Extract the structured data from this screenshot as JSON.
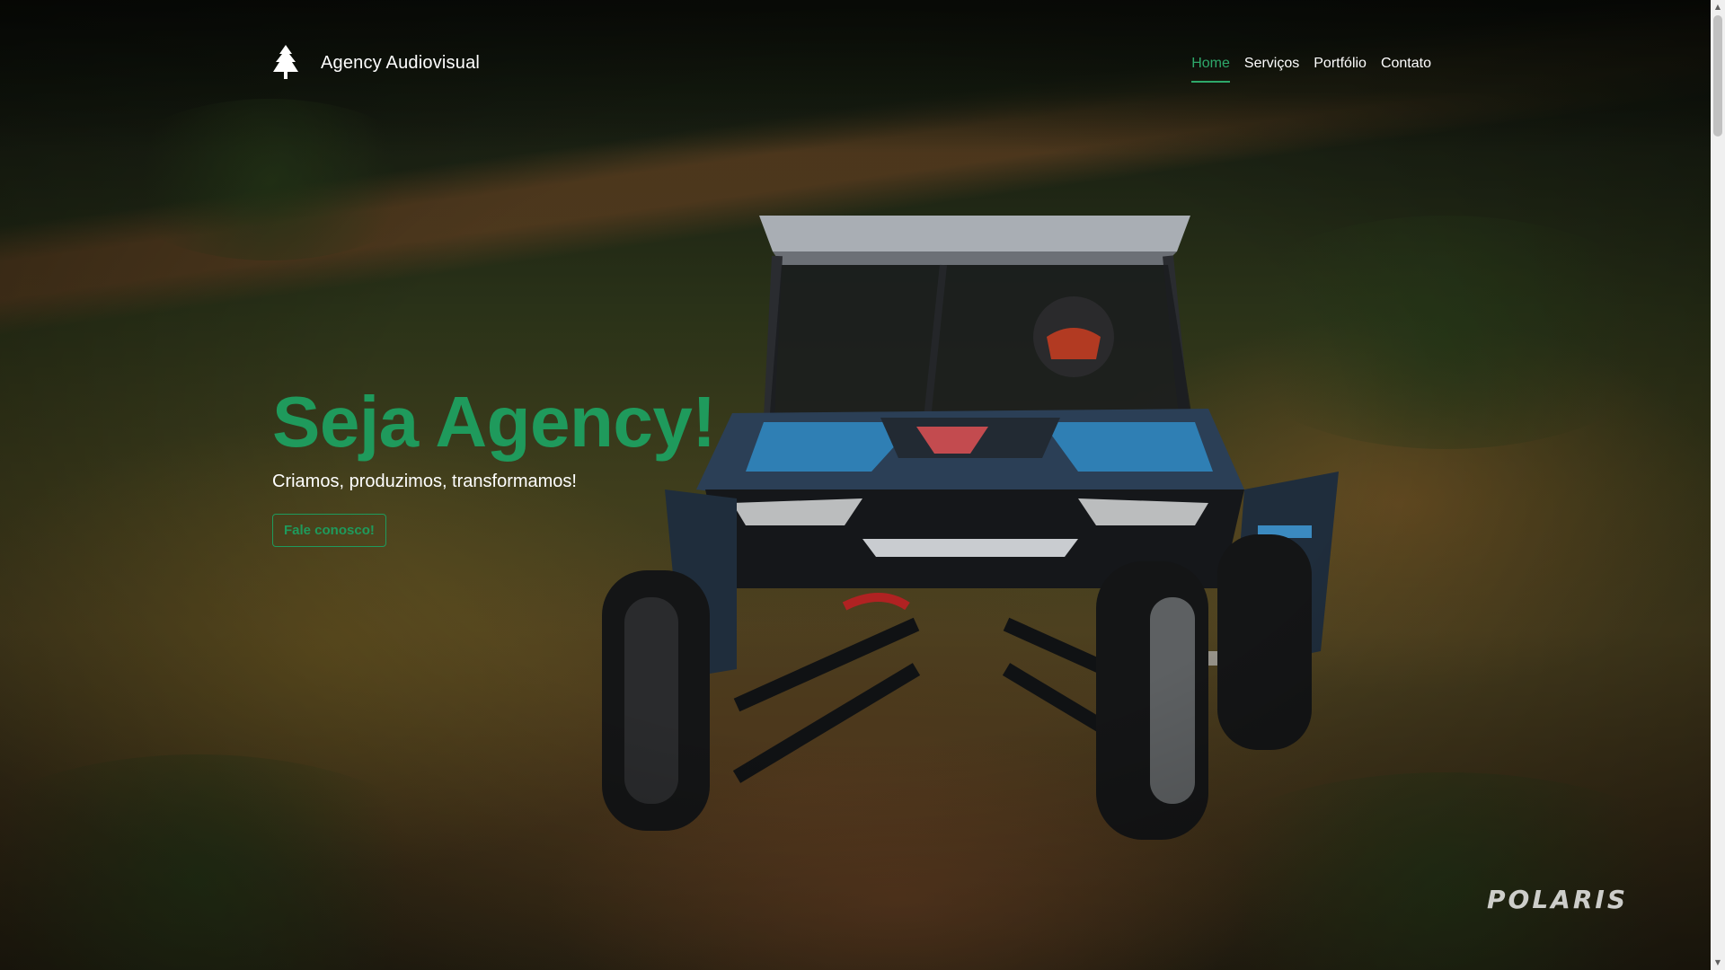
{
  "brand": {
    "name": "Agency Audiovisual",
    "logo_icon": "tree-icon"
  },
  "nav": {
    "items": [
      {
        "label": "Home",
        "active": true
      },
      {
        "label": "Serviços",
        "active": false
      },
      {
        "label": "Portfólio",
        "active": false
      },
      {
        "label": "Contato",
        "active": false
      }
    ]
  },
  "hero": {
    "title": "Seja Agency!",
    "subtitle": "Criamos, produzimos, transformamos!",
    "cta_label": "Fale conosco!"
  },
  "watermark": {
    "text": "POLARIS"
  },
  "colors": {
    "accent": "#1f9a5c",
    "text": "#ffffff"
  }
}
